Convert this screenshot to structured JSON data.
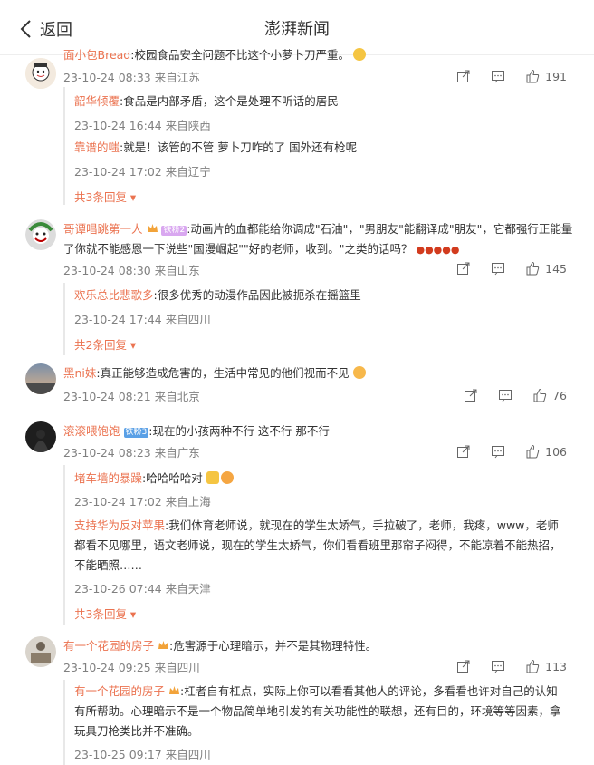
{
  "header": {
    "back_label": "返回",
    "title": "澎湃新闻"
  },
  "comments": [
    {
      "user": "面小包Bread",
      "text": ":校园食品安全问题不比这个小萝卜刀严重。",
      "time": "23-10-24 08:33",
      "location": "来自江苏",
      "likes": "191",
      "replies": [
        {
          "user": "韶华倾覆",
          "text": ":食品是内部矛盾，这个是处理不听话的居民",
          "time": "23-10-24 16:44",
          "location": "来自陕西"
        },
        {
          "user": "靠谱的嗤",
          "text": ":就是！该管的不管 萝卜刀咋的了 国外还有枪呢",
          "time": "23-10-24 17:02",
          "location": "来自辽宁"
        }
      ],
      "more": "共3条回复"
    },
    {
      "user": "哥谭唱跳第一人",
      "badge": "铁粉2",
      "text": ":动画片的血都能给你调成\"石油\"，\"男朋友\"能翻译成\"朋友\"，它都强行正能量了你就不能感恩一下说些\"国漫崛起\"\"好的老师，收到。\"之类的话吗？",
      "time": "23-10-24 08:30",
      "location": "来自山东",
      "likes": "145",
      "replies": [
        {
          "user": "欢乐总比悲歌多",
          "text": ":很多优秀的动漫作品因此被扼杀在摇篮里",
          "time": "23-10-24 17:44",
          "location": "来自四川"
        }
      ],
      "more": "共2条回复"
    },
    {
      "user": "黑ni妹",
      "text": ":真正能够造成危害的，生活中常见的他们视而不见",
      "time": "23-10-24 08:21",
      "location": "来自北京",
      "likes": "76"
    },
    {
      "user": "滚滚喂饱饱",
      "badge": "铁粉3",
      "text": ":现在的小孩两种不行 这不行 那不行",
      "time": "23-10-24 08:23",
      "location": "来自广东",
      "likes": "106",
      "replies": [
        {
          "user": "堵车墙的暴躁",
          "text": ":哈哈哈哈对",
          "time": "23-10-24 17:02",
          "location": "来自上海"
        },
        {
          "user": "支持华为反对苹果",
          "text": ":我们体育老师说，就现在的学生太娇气，手拉破了，老师，我疼，www，老师都看不见哪里，语文老师说，现在的学生太娇气，你们看看班里那帘子闷得，不能凉着不能热招，不能晒照……",
          "time": "23-10-26 07:44",
          "location": "来自天津"
        }
      ],
      "more": "共3条回复"
    },
    {
      "user": "有一个花园的房子",
      "text": ":危害源于心理暗示，并不是其物理特性。",
      "time": "23-10-24 09:25",
      "location": "来自四川",
      "likes": "113",
      "replies": [
        {
          "user": "有一个花园的房子",
          "text": ":杠者自有杠点，实际上你可以看看其他人的评论，多看看也许对自己的认知有所帮助。心理暗示不是一个物品简单地引发的有关功能性的联想，还有目的，环境等等因素，拿玩具刀枪类比并不准确。",
          "time": "23-10-25 09:17",
          "location": "来自四川"
        }
      ]
    }
  ],
  "colors": {
    "username": "#eb7350",
    "meta": "#808080",
    "text": "#333333"
  },
  "icons": [
    "back-chevron-icon",
    "share-icon",
    "comment-icon",
    "like-icon"
  ]
}
